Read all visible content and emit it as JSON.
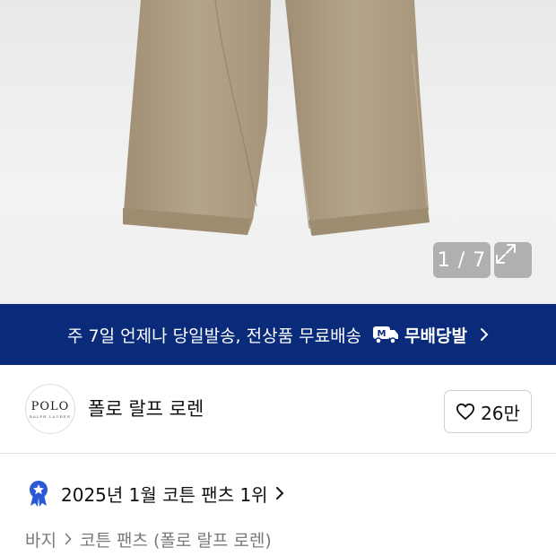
{
  "gallery": {
    "image_index": "1 / 7",
    "product_image_icon": "pants-photo",
    "expand_icon": "expand-icon"
  },
  "banner": {
    "message": "주 7일 언제나 당일발송, 전상품 무료배송",
    "badge_label": "무배당발",
    "badge_icon": "delivery-truck-icon",
    "background": "#0a2b7a"
  },
  "brand": {
    "logo_main": "POLO",
    "logo_sub": "RALPH LAUREN",
    "name": "폴로 랄프 로렌",
    "like_count": "26만",
    "like_icon": "heart-outline-icon"
  },
  "ranking": {
    "text": "2025년 1월 코튼 팬츠 1위",
    "icon": "ribbon-badge-icon"
  },
  "breadcrumb": {
    "items": [
      "바지",
      "코튼 팬츠 (폴로 랄프 로렌)"
    ]
  }
}
